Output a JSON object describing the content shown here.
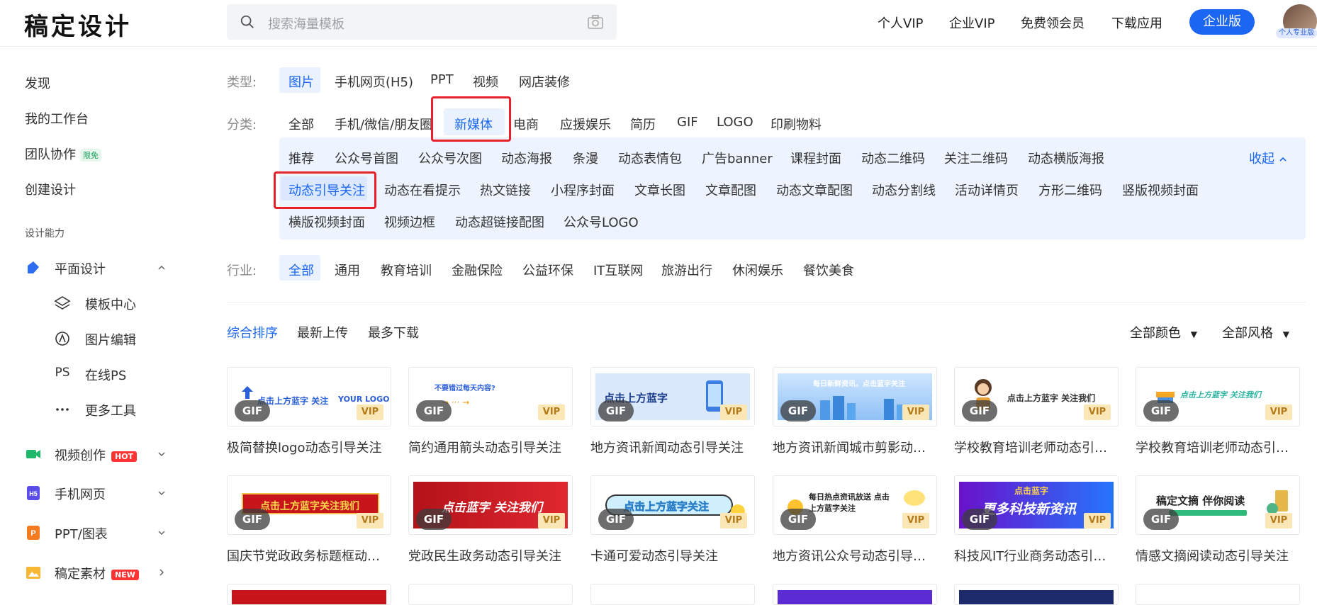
{
  "header": {
    "logo": "稿定设计",
    "search_placeholder": "搜索海量模板",
    "nav": [
      "个人VIP",
      "企业VIP",
      "免费领会员",
      "下载应用"
    ],
    "enterprise_button": "企业版",
    "avatar_badge": "个人专业版"
  },
  "sidebar": {
    "top_items": [
      "发现",
      "我的工作台",
      "团队协作",
      "创建设计"
    ],
    "team_tag": "限免",
    "section_caption": "设计能力",
    "graphic_design": "平面设计",
    "graphic_sub": [
      "模板中心",
      "图片编辑",
      "在线PS",
      "更多工具"
    ],
    "ps_glyph": "PS",
    "video": "视频创作",
    "video_tag": "HOT",
    "mobile": "手机网页",
    "ppt": "PPT/图表",
    "assets": "稿定素材",
    "assets_tag": "NEW"
  },
  "filters": {
    "type_label": "类型:",
    "types": [
      "图片",
      "手机网页(H5)",
      "PPT",
      "视频",
      "网店装修"
    ],
    "category_label": "分类:",
    "categories": [
      "全部",
      "手机/微信/朋友圈",
      "新媒体",
      "电商",
      "应援娱乐",
      "简历",
      "GIF",
      "LOGO",
      "印刷物料"
    ],
    "sub_row1": [
      "推荐",
      "公众号首图",
      "公众号次图",
      "动态海报",
      "条漫",
      "动态表情包",
      "广告banner",
      "课程封面",
      "动态二维码",
      "关注二维码",
      "动态横版海报"
    ],
    "sub_row2": [
      "动态引导关注",
      "动态在看提示",
      "热文链接",
      "小程序封面",
      "文章长图",
      "文章配图",
      "动态文章配图",
      "动态分割线",
      "活动详情页",
      "方形二维码",
      "竖版视频封面"
    ],
    "sub_row3": [
      "横版视频封面",
      "视频边框",
      "动态超链接配图",
      "公众号LOGO"
    ],
    "collapse": "收起",
    "industry_label": "行业:",
    "industries": [
      "全部",
      "通用",
      "教育培训",
      "金融保险",
      "公益环保",
      "IT互联网",
      "旅游出行",
      "休闲娱乐",
      "餐饮美食"
    ]
  },
  "sort": {
    "options": [
      "综合排序",
      "最新上传",
      "最多下载"
    ],
    "color_filter": "全部颜色",
    "style_filter": "全部风格"
  },
  "badges": {
    "gif": "GIF",
    "vip": "VIP"
  },
  "thumb_text": {
    "t1": "点击上方蓝字 关注",
    "t1b": "YOUR LOGO",
    "t2": "不要错过每天内容?",
    "t3": "点击上方蓝字",
    "t4": "每日新鲜资讯，点击蓝字关注",
    "t5": "点击上方蓝字 关注我们",
    "t6": "点击上方蓝字 关注我们",
    "t7": "点击上方蓝字关注我们",
    "t8": "点击蓝字 关注我们",
    "t9": "点击上方蓝字关注",
    "t10": "每日热点资讯放送 点击上方蓝字关注",
    "t11a": "点击蓝字",
    "t11b": "更多科技新资讯",
    "t12": "稿定文摘 伴你阅读"
  },
  "cards_row1": [
    "极简替换logo动态引导关注",
    "简约通用箭头动态引导关注",
    "地方资讯新闻动态引导关注",
    "地方资讯新闻城市剪影动态…",
    "学校教育培训老师动态引导…",
    "学校教育培训老师动态引导…"
  ],
  "cards_row2": [
    "国庆节党政政务标题框动态…",
    "党政民生政务动态引导关注",
    "卡通可爱动态引导关注",
    "地方资讯公众号动态引导关注",
    "科技风IT行业商务动态引导…",
    "情感文摘阅读动态引导关注"
  ],
  "colors": {
    "accent": "#1b66f2",
    "highlight": "#e8202a"
  }
}
